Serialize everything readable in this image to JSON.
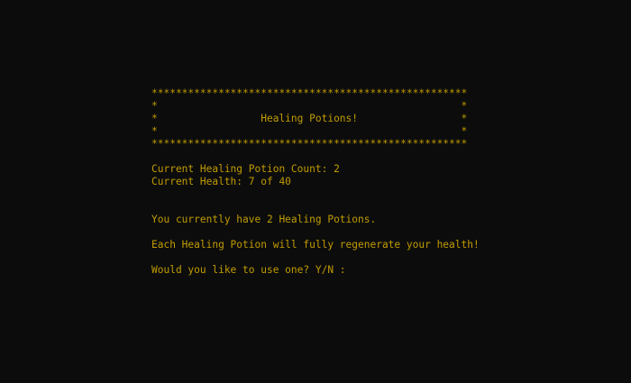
{
  "colors": {
    "background": "#0c0c0c",
    "text": "#c19c00"
  },
  "banner": {
    "border_top": "****************************************************",
    "blank_1": "*                                                  *",
    "title_line": "*                 Healing Potions!                 *",
    "blank_2": "*                                                  *",
    "border_bottom": "****************************************************"
  },
  "stats": {
    "potion_count": "Current Healing Potion Count: 2",
    "health": "Current Health: 7 of 40"
  },
  "messages": {
    "have_potions": "You currently have 2 Healing Potions.",
    "potion_effect": "Each Healing Potion will fully regenerate your health!",
    "prompt": "Would you like to use one? Y/N :"
  }
}
